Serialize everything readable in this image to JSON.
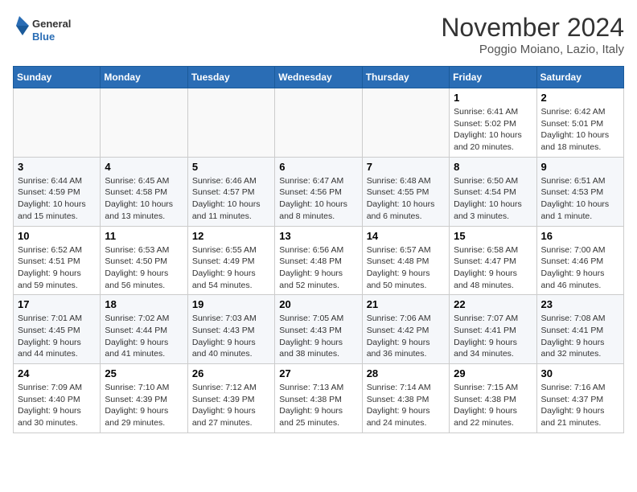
{
  "logo": {
    "general": "General",
    "blue": "Blue"
  },
  "title": "November 2024",
  "location": "Poggio Moiano, Lazio, Italy",
  "days_of_week": [
    "Sunday",
    "Monday",
    "Tuesday",
    "Wednesday",
    "Thursday",
    "Friday",
    "Saturday"
  ],
  "weeks": [
    [
      {
        "day": "",
        "content": ""
      },
      {
        "day": "",
        "content": ""
      },
      {
        "day": "",
        "content": ""
      },
      {
        "day": "",
        "content": ""
      },
      {
        "day": "",
        "content": ""
      },
      {
        "day": "1",
        "content": "Sunrise: 6:41 AM\nSunset: 5:02 PM\nDaylight: 10 hours and 20 minutes."
      },
      {
        "day": "2",
        "content": "Sunrise: 6:42 AM\nSunset: 5:01 PM\nDaylight: 10 hours and 18 minutes."
      }
    ],
    [
      {
        "day": "3",
        "content": "Sunrise: 6:44 AM\nSunset: 4:59 PM\nDaylight: 10 hours and 15 minutes."
      },
      {
        "day": "4",
        "content": "Sunrise: 6:45 AM\nSunset: 4:58 PM\nDaylight: 10 hours and 13 minutes."
      },
      {
        "day": "5",
        "content": "Sunrise: 6:46 AM\nSunset: 4:57 PM\nDaylight: 10 hours and 11 minutes."
      },
      {
        "day": "6",
        "content": "Sunrise: 6:47 AM\nSunset: 4:56 PM\nDaylight: 10 hours and 8 minutes."
      },
      {
        "day": "7",
        "content": "Sunrise: 6:48 AM\nSunset: 4:55 PM\nDaylight: 10 hours and 6 minutes."
      },
      {
        "day": "8",
        "content": "Sunrise: 6:50 AM\nSunset: 4:54 PM\nDaylight: 10 hours and 3 minutes."
      },
      {
        "day": "9",
        "content": "Sunrise: 6:51 AM\nSunset: 4:53 PM\nDaylight: 10 hours and 1 minute."
      }
    ],
    [
      {
        "day": "10",
        "content": "Sunrise: 6:52 AM\nSunset: 4:51 PM\nDaylight: 9 hours and 59 minutes."
      },
      {
        "day": "11",
        "content": "Sunrise: 6:53 AM\nSunset: 4:50 PM\nDaylight: 9 hours and 56 minutes."
      },
      {
        "day": "12",
        "content": "Sunrise: 6:55 AM\nSunset: 4:49 PM\nDaylight: 9 hours and 54 minutes."
      },
      {
        "day": "13",
        "content": "Sunrise: 6:56 AM\nSunset: 4:48 PM\nDaylight: 9 hours and 52 minutes."
      },
      {
        "day": "14",
        "content": "Sunrise: 6:57 AM\nSunset: 4:48 PM\nDaylight: 9 hours and 50 minutes."
      },
      {
        "day": "15",
        "content": "Sunrise: 6:58 AM\nSunset: 4:47 PM\nDaylight: 9 hours and 48 minutes."
      },
      {
        "day": "16",
        "content": "Sunrise: 7:00 AM\nSunset: 4:46 PM\nDaylight: 9 hours and 46 minutes."
      }
    ],
    [
      {
        "day": "17",
        "content": "Sunrise: 7:01 AM\nSunset: 4:45 PM\nDaylight: 9 hours and 44 minutes."
      },
      {
        "day": "18",
        "content": "Sunrise: 7:02 AM\nSunset: 4:44 PM\nDaylight: 9 hours and 41 minutes."
      },
      {
        "day": "19",
        "content": "Sunrise: 7:03 AM\nSunset: 4:43 PM\nDaylight: 9 hours and 40 minutes."
      },
      {
        "day": "20",
        "content": "Sunrise: 7:05 AM\nSunset: 4:43 PM\nDaylight: 9 hours and 38 minutes."
      },
      {
        "day": "21",
        "content": "Sunrise: 7:06 AM\nSunset: 4:42 PM\nDaylight: 9 hours and 36 minutes."
      },
      {
        "day": "22",
        "content": "Sunrise: 7:07 AM\nSunset: 4:41 PM\nDaylight: 9 hours and 34 minutes."
      },
      {
        "day": "23",
        "content": "Sunrise: 7:08 AM\nSunset: 4:41 PM\nDaylight: 9 hours and 32 minutes."
      }
    ],
    [
      {
        "day": "24",
        "content": "Sunrise: 7:09 AM\nSunset: 4:40 PM\nDaylight: 9 hours and 30 minutes."
      },
      {
        "day": "25",
        "content": "Sunrise: 7:10 AM\nSunset: 4:39 PM\nDaylight: 9 hours and 29 minutes."
      },
      {
        "day": "26",
        "content": "Sunrise: 7:12 AM\nSunset: 4:39 PM\nDaylight: 9 hours and 27 minutes."
      },
      {
        "day": "27",
        "content": "Sunrise: 7:13 AM\nSunset: 4:38 PM\nDaylight: 9 hours and 25 minutes."
      },
      {
        "day": "28",
        "content": "Sunrise: 7:14 AM\nSunset: 4:38 PM\nDaylight: 9 hours and 24 minutes."
      },
      {
        "day": "29",
        "content": "Sunrise: 7:15 AM\nSunset: 4:38 PM\nDaylight: 9 hours and 22 minutes."
      },
      {
        "day": "30",
        "content": "Sunrise: 7:16 AM\nSunset: 4:37 PM\nDaylight: 9 hours and 21 minutes."
      }
    ]
  ]
}
